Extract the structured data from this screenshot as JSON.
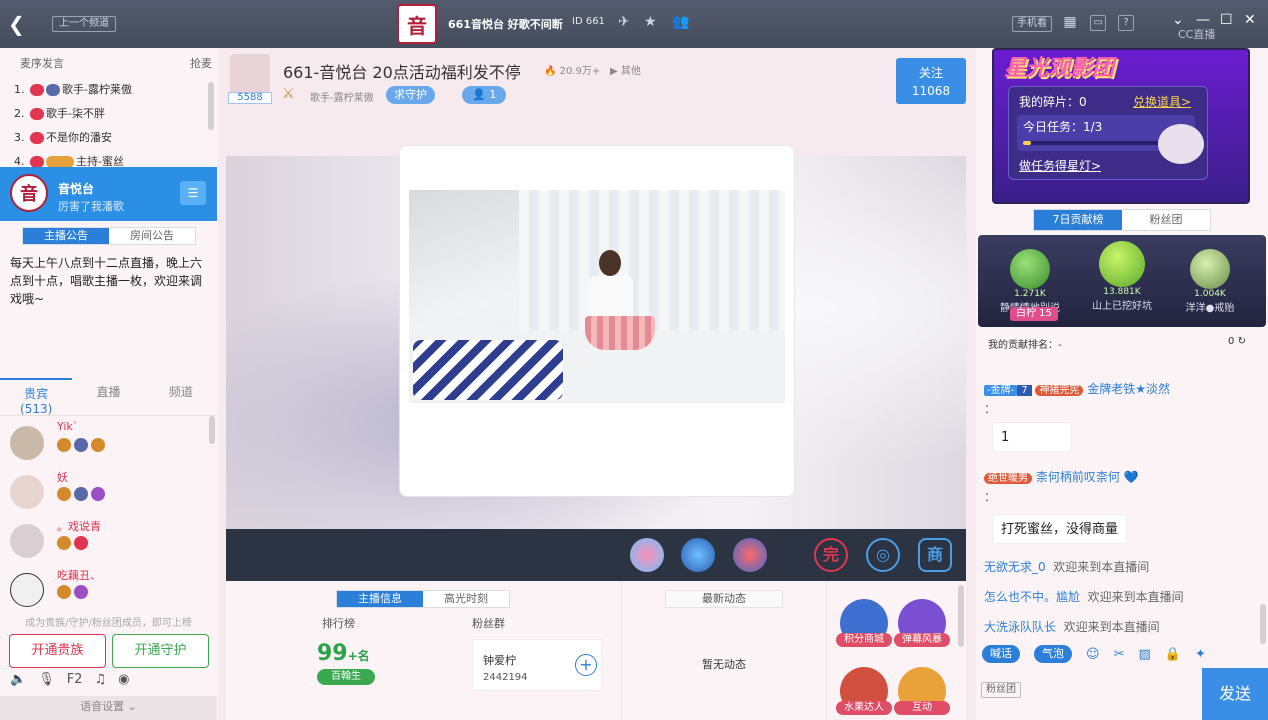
{
  "topbar": {
    "prev_channel": "上一个频道",
    "channel_title": "661音悦台 好歌不间断",
    "channel_id": "661",
    "phone_view": "手机看",
    "help": "?",
    "cc_logo": "CC直播"
  },
  "left": {
    "header": "麦序发言",
    "grab_mic": "抢麦",
    "rank": [
      {
        "n": "1.",
        "name": "歌手-露柠莱傲"
      },
      {
        "n": "2.",
        "name": "歌手-柒不胖"
      },
      {
        "n": "3.",
        "name": "不是你的潘安"
      },
      {
        "n": "4.",
        "name": "主持-蜜丝"
      }
    ],
    "anchor": {
      "logo": "音",
      "name": "音悦台",
      "sub": "厉害了我潘歌"
    },
    "notice_tabs": [
      "主播公告",
      "房间公告"
    ],
    "notice": "每天上午八点到十二点直播，晚上六点到十点，唱歌主播一枚，欢迎来调戏哦~",
    "user_tabs": [
      "贵宾",
      "直播",
      "频道"
    ],
    "guest_count": "(513)",
    "users": [
      {
        "name": "Yik`"
      },
      {
        "name": "妖"
      },
      {
        "name": "。戏说青"
      },
      {
        "name": "吃藕丑、"
      }
    ],
    "hint": "成为贵族/守护/粉丝团成员，即可上榜",
    "open_noble": "开通贵族",
    "open_guard": "开通守护",
    "voice_settings": "语音设置"
  },
  "center": {
    "fans": "5588",
    "room_title": "661-音悦台 20点活动福利发不停",
    "heat": "20.9万+",
    "other": "其他",
    "sub": "歌手-露柠莱傲",
    "guard_btn": "求守护",
    "guard_count": "1",
    "follow": "关注",
    "follow_count": "11068",
    "lower_tabs": [
      "主播信息",
      "高光时刻"
    ],
    "rank_label": "排行榜",
    "fans_label": "粉丝群",
    "rank_num": "99",
    "rank_suffix": "+名",
    "rank_badge": "百翰生",
    "fan_group_name": "钟爱柠",
    "fan_group_id": "2442194",
    "news_title": "最新动态",
    "no_news": "暂无动态",
    "activities": [
      "积分商城",
      "弹幕风暴",
      "水果达人",
      "互动"
    ],
    "toolbar_icons": [
      "完",
      "商"
    ]
  },
  "right": {
    "banner_title": "星光观影团",
    "fragments": "我的碎片：0",
    "exchange": "兑换道具>",
    "task": "今日任务：1/3",
    "task_progress": 0.05,
    "do_task": "做任务得星灯>",
    "tabs": [
      "7日贡献榜",
      "粉丝团"
    ],
    "podium": [
      {
        "score": "1.271K",
        "name": "静情情地别说"
      },
      {
        "score": "13.881K",
        "name": "山上已挖好坑"
      },
      {
        "score": "1.004K",
        "name": "洋洋●戒贻"
      }
    ],
    "pin": "白柠 15",
    "my_rank": "我的贡献排名：-",
    "my_rank_val": "0",
    "chat": {
      "m1_level": "-金牌-",
      "m1_level_num": "7",
      "m1_tag": "神猪完宪",
      "m1_name": "金牌老铁★淡然",
      "m1_colon": "：",
      "b1": "1",
      "m2_tag": "绝世暖男",
      "m2_name": "柰何柄前叹柰何",
      "m2_colon": "：",
      "b2": "打死蜜丝，没得商量",
      "j1_name": "无欲无求_0",
      "j2_name": "怎么也不中。尴尬",
      "j3_name": "大洗泳队队长",
      "join": "欢迎来到本直播间"
    },
    "tool_pills": [
      "喊话",
      "气泡"
    ],
    "fans_badge": "粉丝团",
    "send": "发送"
  }
}
